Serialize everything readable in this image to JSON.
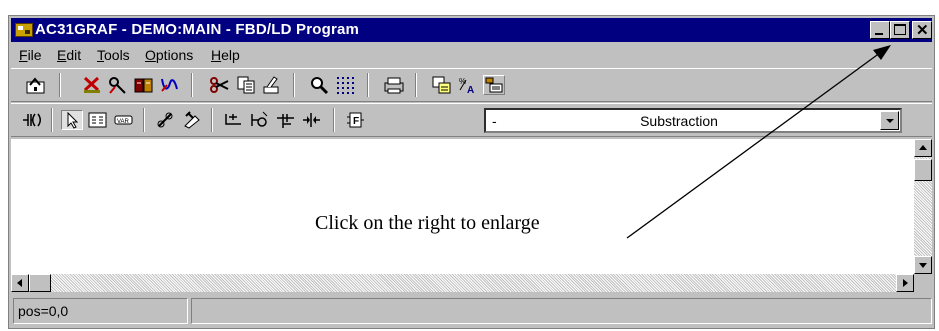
{
  "window": {
    "title": "AC31GRAF - DEMO:MAIN - FBD/LD Program",
    "controls": [
      "minimize",
      "maximize",
      "close"
    ]
  },
  "menu": [
    {
      "label": "File",
      "key": "F",
      "rest": "ile"
    },
    {
      "label": "Edit",
      "key": "E",
      "rest": "dit"
    },
    {
      "label": "Tools",
      "key": "T",
      "rest": "ools"
    },
    {
      "label": "Options",
      "key": "O",
      "rest": "ptions"
    },
    {
      "label": "Help",
      "key": "H",
      "rest": "elp"
    }
  ],
  "toolbar1": {
    "icons": [
      "save-icon",
      "cut-delete-icon",
      "connect-icon",
      "book-icon",
      "graph-icon",
      "scissors-icon",
      "copy-icon",
      "paste-icon",
      "find-icon",
      "grid-icon",
      "print-icon",
      "document-icon",
      "translate-icon",
      "variables-icon"
    ]
  },
  "toolbar2": {
    "icons": [
      "contact-icon",
      "pointer-icon",
      "block-icon",
      "variable-icon",
      "link-icon",
      "tag-icon",
      "jump-icon",
      "label-icon",
      "coil-icon",
      "step-icon",
      "fbd-icon"
    ],
    "combo": {
      "prefix": "-",
      "value": "Substraction"
    }
  },
  "statusbar": {
    "position": "pos=0,0"
  },
  "annotation": {
    "text": "Click on the right to enlarge"
  },
  "colors": {
    "titlebar": "#000080",
    "face": "#c0c0c0"
  }
}
